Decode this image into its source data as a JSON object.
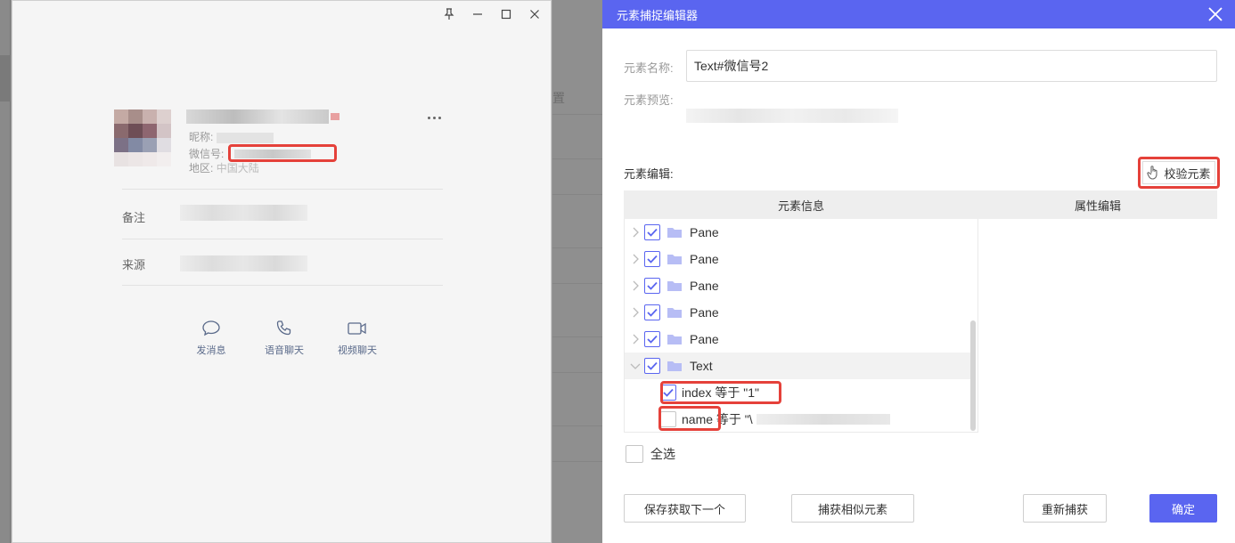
{
  "contact_card": {
    "nickname_label": "昵称:",
    "wechat_id_label": "微信号:",
    "region_label": "地区:",
    "region_value": "中国大陆",
    "remark_label": "备注",
    "source_label": "来源",
    "actions": [
      {
        "label": "发消息",
        "icon": "chat-bubble-icon"
      },
      {
        "label": "语音聊天",
        "icon": "phone-icon"
      },
      {
        "label": "视频聊天",
        "icon": "video-camera-icon"
      }
    ],
    "window_controls": [
      "pin-icon",
      "minimize-icon",
      "maximize-icon",
      "close-icon"
    ]
  },
  "background_app": {
    "partial_text": "置"
  },
  "dialog": {
    "title": "元素捕捉编辑器",
    "element_name_label": "元素名称:",
    "element_name_value": "Text#微信号2",
    "element_preview_label": "元素预览:",
    "element_edit_label": "元素编辑:",
    "verify_button": "校验元素",
    "table_headers": [
      "元素信息",
      "属性编辑"
    ],
    "tree_rows": [
      {
        "label": "Pane",
        "checked": true,
        "expanded": false
      },
      {
        "label": "Pane",
        "checked": true,
        "expanded": false
      },
      {
        "label": "Pane",
        "checked": true,
        "expanded": false
      },
      {
        "label": "Pane",
        "checked": true,
        "expanded": false
      },
      {
        "label": "Pane",
        "checked": true,
        "expanded": false
      },
      {
        "label": "Text",
        "checked": true,
        "expanded": true
      }
    ],
    "attributes": [
      {
        "text": "index 等于 \"1\"",
        "checked": true
      },
      {
        "text": "name 等于 \"\\",
        "checked": false
      }
    ],
    "select_all_label": "全选",
    "buttons": {
      "save_next": "保存获取下一个",
      "capture_similar": "捕获相似元素",
      "recapture": "重新捕获",
      "confirm": "确定"
    },
    "colors": {
      "accent": "#5a65f0",
      "highlight_box": "#e5413a"
    }
  }
}
